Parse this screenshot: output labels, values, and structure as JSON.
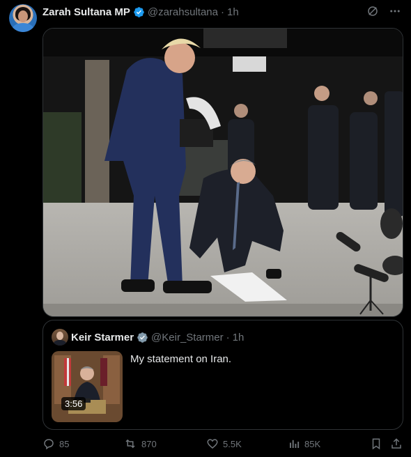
{
  "author": {
    "name": "Zarah Sultana MP",
    "handle": "@zarahsultana",
    "separator": "·",
    "time": "1h"
  },
  "header_icons": [
    "grok-icon",
    "more-icon"
  ],
  "quoted_post": {
    "author": {
      "name": "Keir Starmer",
      "handle": "@Keir_Starmer",
      "separator": "·",
      "time": "1h"
    },
    "text": "My statement on Iran.",
    "video_duration": "3:56"
  },
  "actions": {
    "replies": "85",
    "reposts": "870",
    "likes": "5.5K",
    "views": "85K"
  },
  "colors": {
    "background": "#000000",
    "text": "#e7e9ea",
    "muted": "#71767b",
    "border": "#2f3336",
    "verified": "#1d9bf0"
  }
}
